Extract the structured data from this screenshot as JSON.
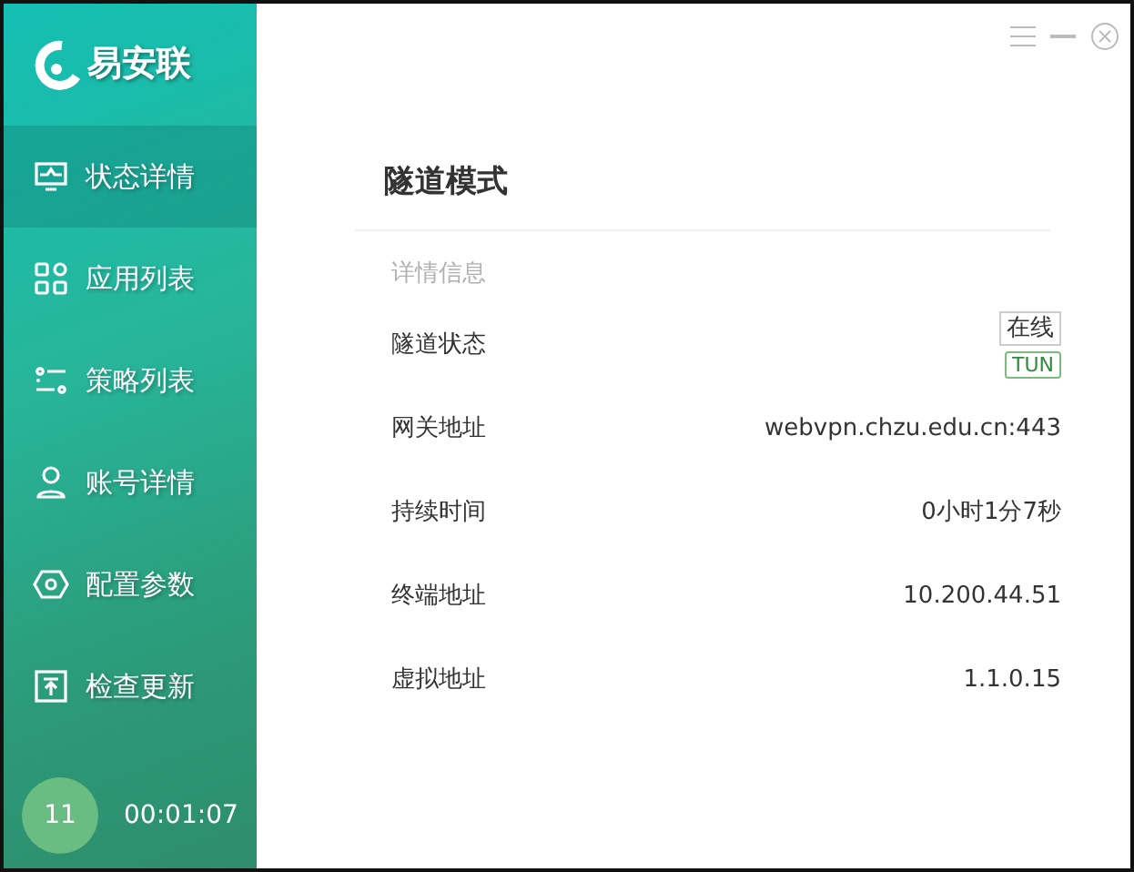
{
  "app": {
    "name": "易安联"
  },
  "sidebar": {
    "items": [
      {
        "label": "状态详情",
        "kind": "monitor",
        "selected": true
      },
      {
        "label": "应用列表",
        "kind": "apps",
        "selected": false
      },
      {
        "label": "策略列表",
        "kind": "sliders",
        "selected": false
      },
      {
        "label": "账号详情",
        "kind": "user",
        "selected": false
      },
      {
        "label": "配置参数",
        "kind": "hexagon",
        "selected": false
      },
      {
        "label": "检查更新",
        "kind": "upload",
        "selected": false
      }
    ],
    "footer": {
      "count": "11",
      "timer": "00:01:07"
    }
  },
  "main": {
    "title": "隧道模式",
    "section": "详情信息",
    "rows": [
      {
        "label": "隧道状态",
        "kind": "tags",
        "tags": [
          "在线",
          "TUN"
        ]
      },
      {
        "label": "网关地址",
        "kind": "text",
        "value": "webvpn.chzu.edu.cn:443"
      },
      {
        "label": "持续时间",
        "kind": "text",
        "value": "0小时1分7秒"
      },
      {
        "label": "终端地址",
        "kind": "text",
        "value": "10.200.44.51"
      },
      {
        "label": "虚拟地址",
        "kind": "text",
        "value": "1.1.0.15"
      }
    ]
  }
}
